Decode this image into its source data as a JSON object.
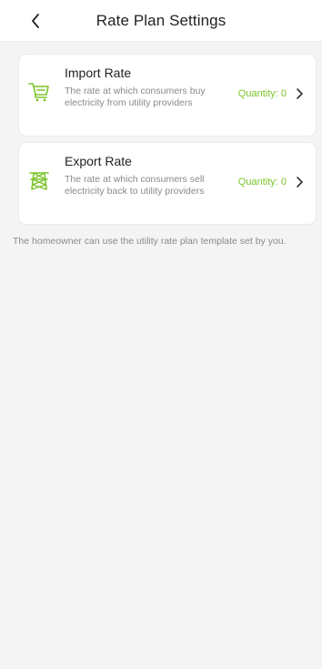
{
  "header": {
    "title": "Rate Plan Settings"
  },
  "icons": {
    "back": "chevron-left-icon",
    "import": "shopping-cart-icon",
    "export": "power-tower-icon",
    "row_chevron": "chevron-right-icon"
  },
  "colors": {
    "accent": "#7cc42b",
    "background": "#f4f4f5",
    "card": "#ffffff",
    "muted_text": "#8a8a8a"
  },
  "cards": [
    {
      "title": "Import Rate",
      "description": "The rate at which consumers buy electricity from utility providers",
      "quantity": "Quantity: 0"
    },
    {
      "title": "Export Rate",
      "description": "The rate at which consumers sell electricity back to utility providers",
      "quantity": "Quantity: 0"
    }
  ],
  "note": "The homeowner can use the utility rate plan template set by you."
}
